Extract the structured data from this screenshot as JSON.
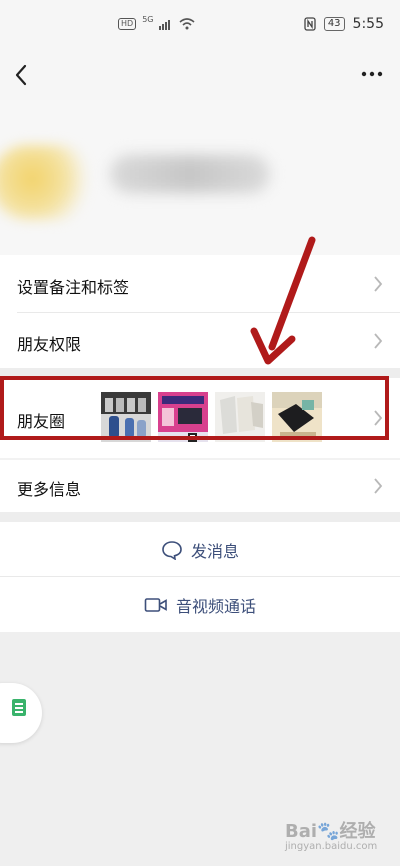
{
  "status_bar": {
    "left_badges": [
      "HD",
      "5G"
    ],
    "battery": "43",
    "time": "5:55"
  },
  "top_bar": {
    "back_icon": "chevron-left-icon",
    "more_icon": "more-dots-icon"
  },
  "menu_items": [
    {
      "label": "设置备注和标签"
    },
    {
      "label": "朋友权限"
    },
    {
      "label": "朋友圈"
    },
    {
      "label": "更多信息"
    }
  ],
  "actions": {
    "message": "发消息",
    "call": "音视频通话"
  },
  "watermark": {
    "main": "Bai🐾经验",
    "sub": "jingyan.baidu.com"
  },
  "colors": {
    "highlight": "#b01a1a",
    "action_text": "#3d4f7a"
  }
}
